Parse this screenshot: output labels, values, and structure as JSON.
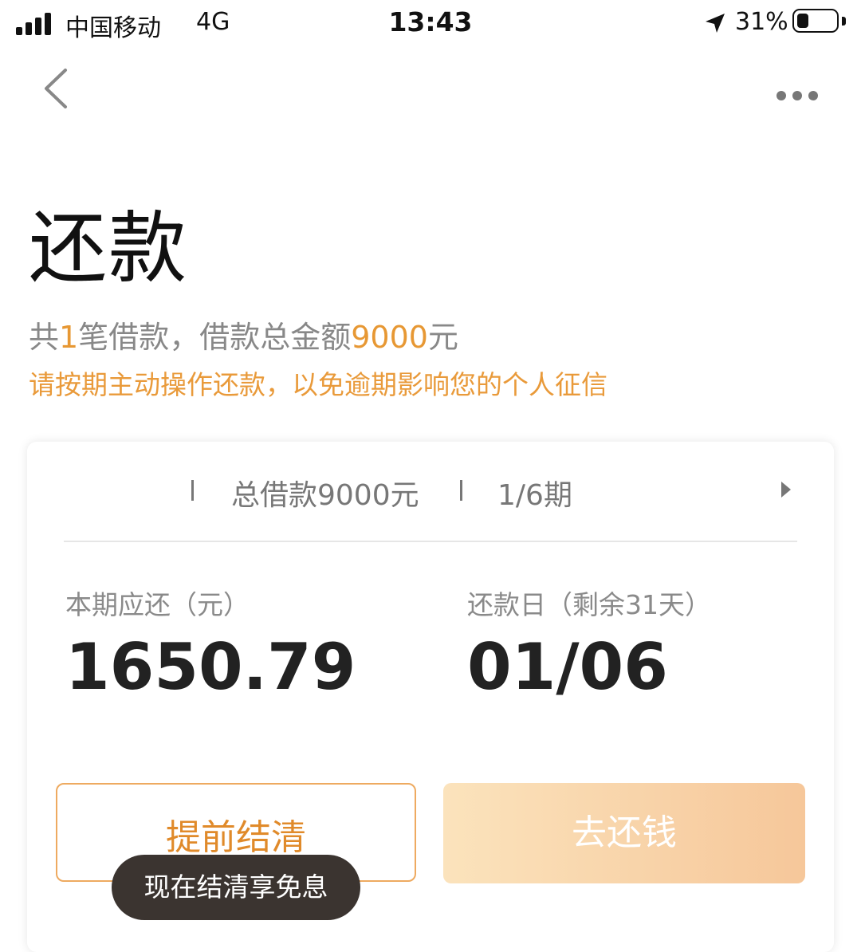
{
  "status_bar": {
    "carrier": "中国移动",
    "network": "4G",
    "time": "13:43",
    "battery_pct": "31%",
    "battery_level": 0.31
  },
  "nav": {
    "back_icon": "chevron-left-icon",
    "more_icon": "ellipsis-icon"
  },
  "page": {
    "title": "还款",
    "summary_prefix": "共",
    "summary_count": "1",
    "summary_mid": "笔借款，借款总金额",
    "summary_total": "9000",
    "summary_suffix": "元",
    "notice": "请按期主动操作还款，以免逾期影响您的个人征信"
  },
  "card": {
    "loan_total": "总借款9000元",
    "term": "1/6期",
    "due_label": "本期应还（元）",
    "due_amount": "1650.79",
    "date_label": "还款日（剩余31天）",
    "due_date": "01/06",
    "settle_button": "提前结清",
    "repay_button": "去还钱",
    "tooltip": "现在结清享免息"
  },
  "colors": {
    "accent": "#e79834",
    "button_gradient_start": "#fbe3bc",
    "button_gradient_end": "#f6c79a",
    "tooltip_bg": "#3b3430"
  }
}
